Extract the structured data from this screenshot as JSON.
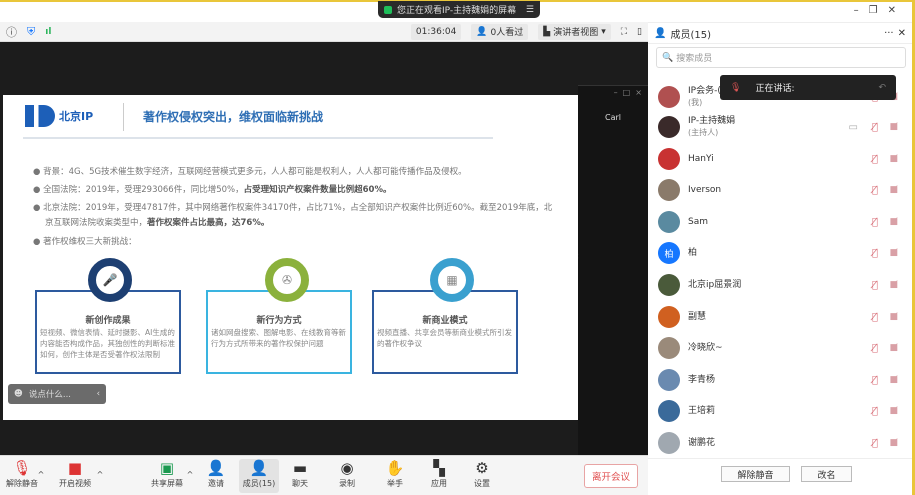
{
  "share_banner": "您正在观看IP-主持魏娟的屏幕",
  "infobar": {
    "timer": "01:36:04",
    "viewers": "0人看过",
    "view_mode": "演讲者视图"
  },
  "remote_window": {
    "label": "Carl"
  },
  "slide": {
    "logo_text": "北京IP",
    "title": "著作权侵权突出，维权面临新挑战",
    "bullets": [
      {
        "text": "背景：4G、5G技术催生数字经济，互联网经营模式更多元，人人都可能是权利人，人人都可能传播作品及侵权。",
        "bold": ""
      },
      {
        "text": "全国法院：2019年，受理293066件，同比增50%，",
        "bold": "占受理知识产权案件数量比例超60%。"
      },
      {
        "text": "北京法院：2019年，受理47817件，其中网络著作权案件34170件，占比71%，占全部知识产权案件比例近60%。截至2019年底，北京互联网法院收案类型中，",
        "bold": "著作权案件占比最高，达76%。"
      },
      {
        "text": "著作权维权三大新挑战：",
        "bold": ""
      }
    ],
    "cards": [
      {
        "title": "新创作成果",
        "body": "短视频、微信表情、延时摄影、AI生成的内容能否构成作品，其独创性的判断标准如何，创作主体是否受著作权法限制",
        "color": "#1d3f72",
        "icon": "microphone-icon"
      },
      {
        "title": "新行为方式",
        "body": "诸如网盘搜索、图解电影、在线教育等新行为方式所带来的著作权保护问题",
        "color": "#8bb13c",
        "icon": "film-reel-icon"
      },
      {
        "title": "新商业模式",
        "body": "视频直播、共享会员等新商业模式所引发的著作权争议",
        "color": "#3aa0cf",
        "icon": "film-strip-icon"
      }
    ]
  },
  "chat_input": {
    "placeholder": "说点什么..."
  },
  "toolbar": {
    "unmute": "解除静音",
    "video": "开启视频",
    "share": "共享屏幕",
    "invite": "邀请",
    "members": "成员(15)",
    "chat": "聊天",
    "record": "录制",
    "raise_hand": "举手",
    "apps": "应用",
    "settings": "设置",
    "leave": "离开会议"
  },
  "panel": {
    "title": "成员(15)",
    "search_placeholder": "搜索成员",
    "speaking_label": "正在讲话:",
    "members": [
      {
        "name": "IP会务-(",
        "sub": "(我)",
        "color": "#b05050"
      },
      {
        "name": "IP-主持魏娟",
        "sub": "(主持人)",
        "color": "#3a2a2a"
      },
      {
        "name": "HanYi",
        "sub": "",
        "color": "#c83232"
      },
      {
        "name": "Iverson",
        "sub": "",
        "color": "#8a7a6a"
      },
      {
        "name": "Sam",
        "sub": "",
        "color": "#5a8aa0"
      },
      {
        "name": "柏",
        "sub": "",
        "color": "#1677ff",
        "initial": "柏"
      },
      {
        "name": "北京ip屈景润",
        "sub": "",
        "color": "#4a5a3a"
      },
      {
        "name": "副慧",
        "sub": "",
        "color": "#d06020"
      },
      {
        "name": "冷晓欣~",
        "sub": "",
        "color": "#9a8a7a"
      },
      {
        "name": "李青杨",
        "sub": "",
        "color": "#6a8ab0"
      },
      {
        "name": "王培莉",
        "sub": "",
        "color": "#3a6a9a"
      },
      {
        "name": "谢鹏花",
        "sub": "",
        "color": "#a0a8b0"
      }
    ],
    "unmute_all": "解除静音",
    "rename": "改名"
  }
}
